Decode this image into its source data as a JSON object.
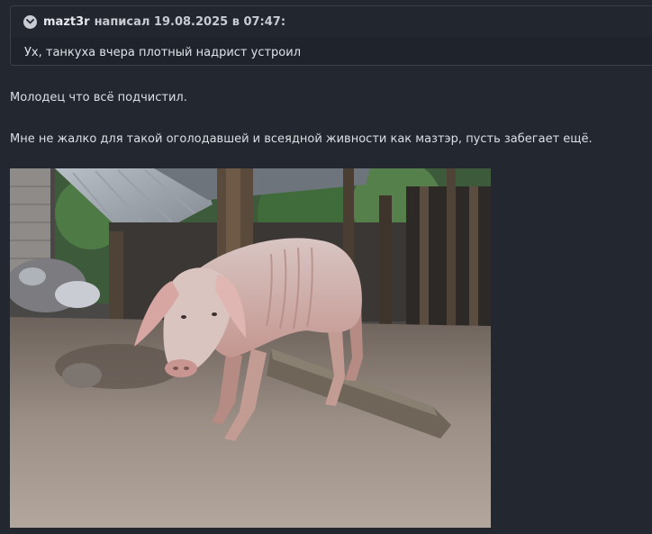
{
  "quote": {
    "author": "mazt3r",
    "meta": "написал 19.08.2025 в 07:47:",
    "text": "Ух, танкуха вчера плотный надрист устроил"
  },
  "message": {
    "line1": "Молодец что всё подчистил.",
    "line2": "Мне не жалко для такой оголодавшей и всеядной живности как мазтэр, пусть забегает ещё."
  },
  "image": {
    "subject": "photo-of-pig"
  },
  "colors": {
    "background": "#232730",
    "quote_bg": "#1f232b",
    "quote_header_bg": "#22262e",
    "border": "#3a3f49",
    "text": "#dcdfe4"
  }
}
